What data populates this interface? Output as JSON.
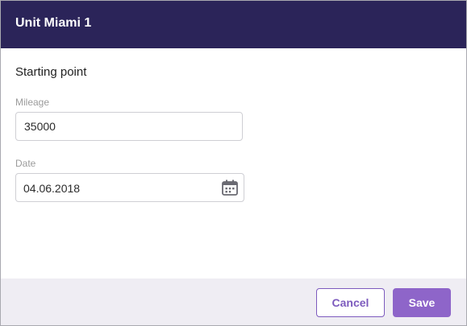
{
  "header": {
    "title": "Unit Miami 1"
  },
  "form": {
    "section_title": "Starting point",
    "mileage": {
      "label": "Mileage",
      "value": "35000"
    },
    "date": {
      "label": "Date",
      "value": "04.06.2018",
      "icon": "calendar-icon"
    }
  },
  "footer": {
    "cancel_label": "Cancel",
    "save_label": "Save"
  },
  "colors": {
    "header_bg": "#2b2459",
    "accent": "#8e65c9",
    "footer_bg": "#efedf3"
  }
}
